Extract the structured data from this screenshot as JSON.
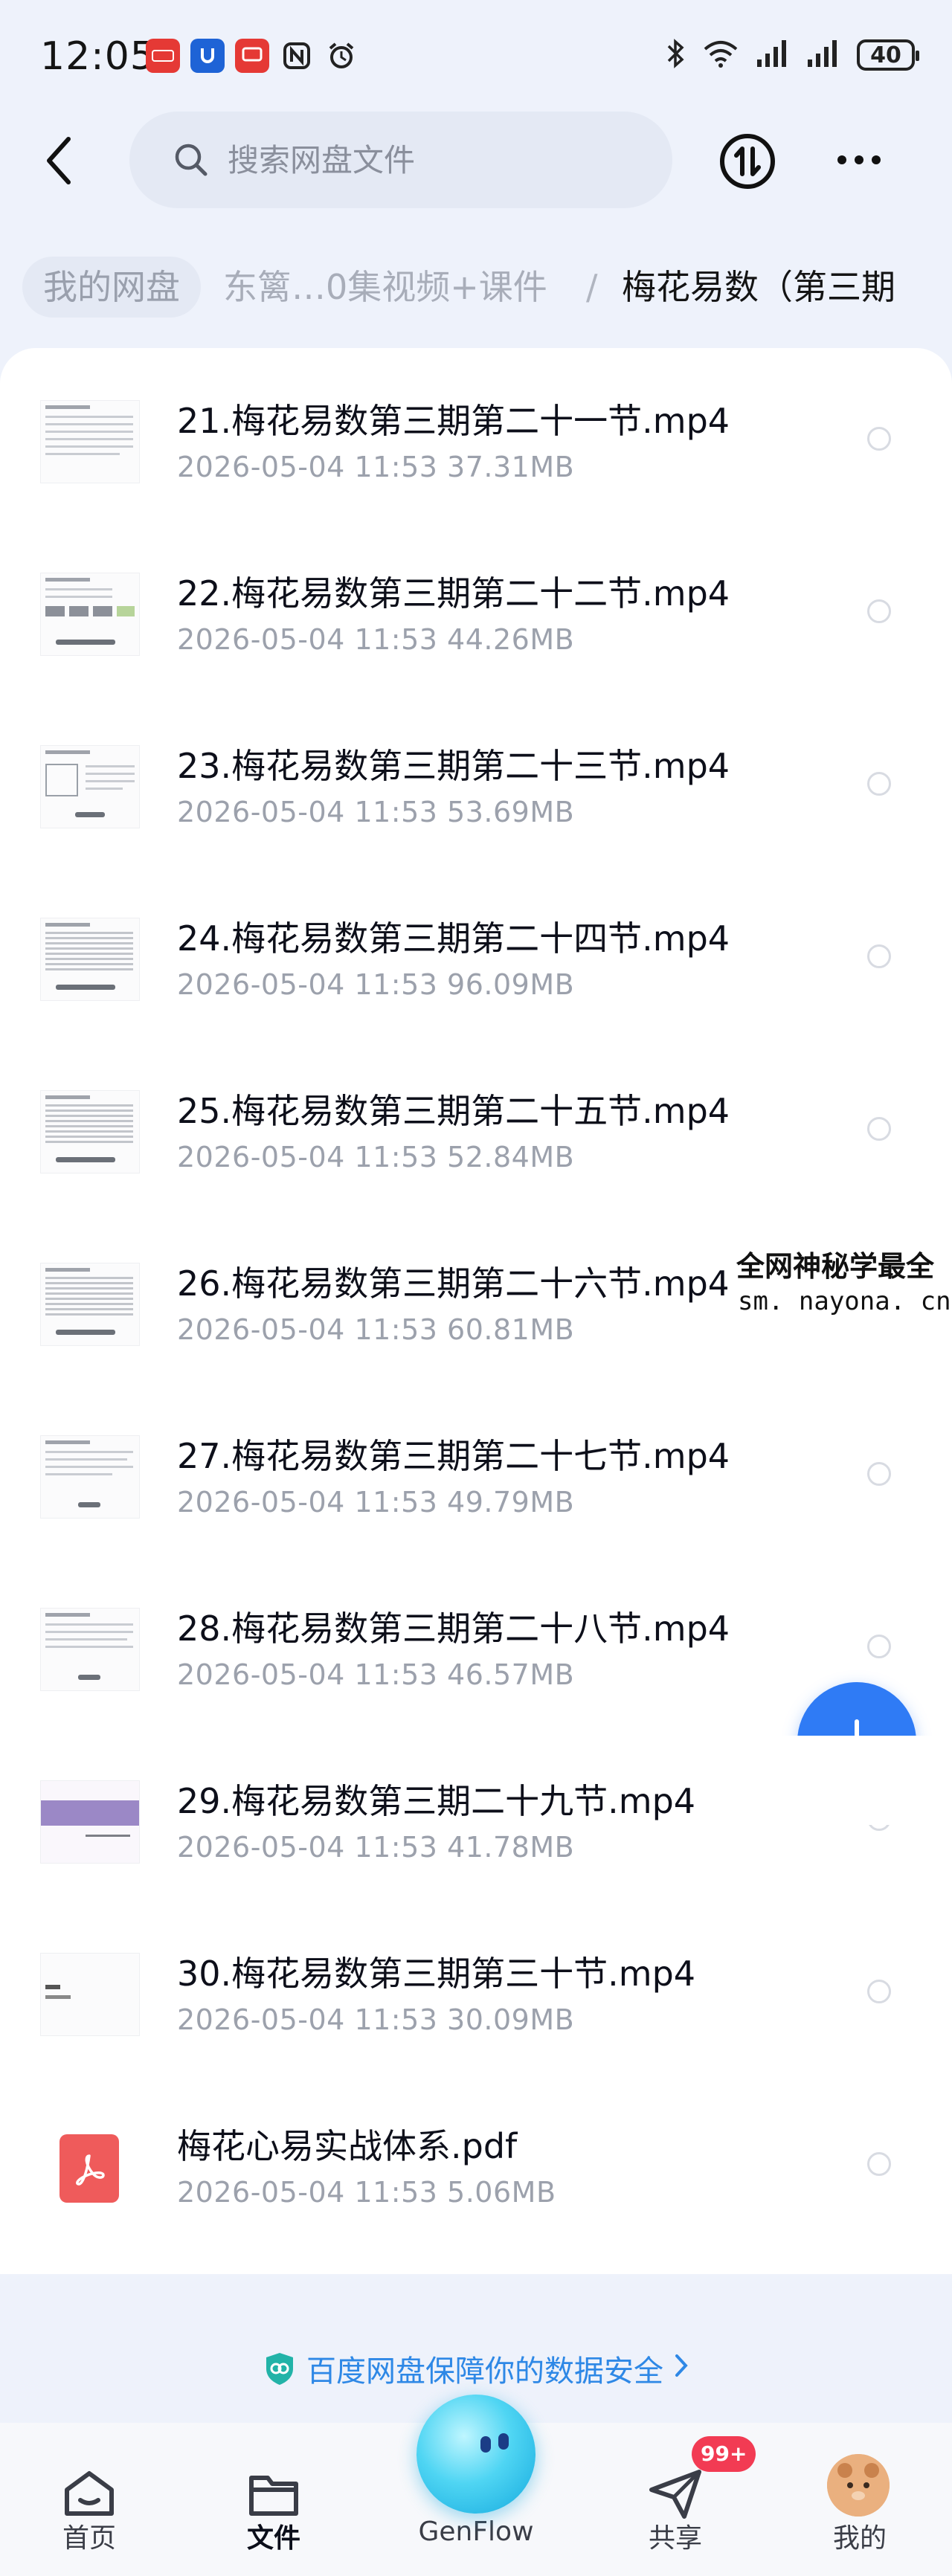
{
  "status_bar": {
    "time": "12:05",
    "battery": "40",
    "app_icons": [
      {
        "name": "news-app-icon",
        "color": "#e53935"
      },
      {
        "name": "u-app-icon",
        "color": "#1e63d6"
      },
      {
        "name": "tv-app-icon",
        "color": "#e53935"
      },
      {
        "name": "nfc-icon",
        "color": "#222222"
      },
      {
        "name": "alarm-icon",
        "color": "#222222"
      }
    ]
  },
  "header": {
    "search_placeholder": "搜索网盘文件"
  },
  "breadcrumb": {
    "root": "我的网盘",
    "middle": "东篱…0集视频+课件",
    "separator": "/",
    "current": "梅花易数（第三期"
  },
  "files": [
    {
      "name": "21.梅花易数第三期第二十一节.mp4",
      "date": "2026-05-04",
      "time": "11:53",
      "size": "37.31MB",
      "type": "video"
    },
    {
      "name": "22.梅花易数第三期第二十二节.mp4",
      "date": "2026-05-04",
      "time": "11:53",
      "size": "44.26MB",
      "type": "video"
    },
    {
      "name": "23.梅花易数第三期第二十三节.mp4",
      "date": "2026-05-04",
      "time": "11:53",
      "size": "53.69MB",
      "type": "video"
    },
    {
      "name": "24.梅花易数第三期第二十四节.mp4",
      "date": "2026-05-04",
      "time": "11:53",
      "size": "96.09MB",
      "type": "video"
    },
    {
      "name": "25.梅花易数第三期第二十五节.mp4",
      "date": "2026-05-04",
      "time": "11:53",
      "size": "52.84MB",
      "type": "video"
    },
    {
      "name": "26.梅花易数第三期第二十六节.mp4",
      "date": "2026-05-04",
      "time": "11:53",
      "size": "60.81MB",
      "type": "video"
    },
    {
      "name": "27.梅花易数第三期第二十七节.mp4",
      "date": "2026-05-04",
      "time": "11:53",
      "size": "49.79MB",
      "type": "video"
    },
    {
      "name": "28.梅花易数第三期第二十八节.mp4",
      "date": "2026-05-04",
      "time": "11:53",
      "size": "46.57MB",
      "type": "video"
    },
    {
      "name": "29.梅花易数第三期二十九节.mp4",
      "date": "2026-05-04",
      "time": "11:53",
      "size": "41.78MB",
      "type": "video"
    },
    {
      "name": "30.梅花易数第三期第三十节.mp4",
      "date": "2026-05-04",
      "time": "11:53",
      "size": "30.09MB",
      "type": "video"
    },
    {
      "name": "梅花心易实战体系.pdf",
      "date": "2026-05-04",
      "time": "11:53",
      "size": "5.06MB",
      "type": "pdf"
    }
  ],
  "watermark": {
    "line1": "全网神秘学最全",
    "line2": "sm. nayona. cn"
  },
  "security_banner": {
    "text": "百度网盘保障你的数据安全",
    "icon": "shield-icon"
  },
  "bottom_nav": {
    "items": [
      {
        "label": "首页",
        "icon": "home-icon"
      },
      {
        "label": "文件",
        "icon": "folder-icon",
        "active": true
      },
      {
        "label": "GenFlow",
        "icon": "genflow-orb-icon"
      },
      {
        "label": "共享",
        "icon": "paper-plane-icon"
      },
      {
        "label": "我的",
        "icon": "avatar-icon"
      }
    ],
    "share_badge": "99+"
  }
}
